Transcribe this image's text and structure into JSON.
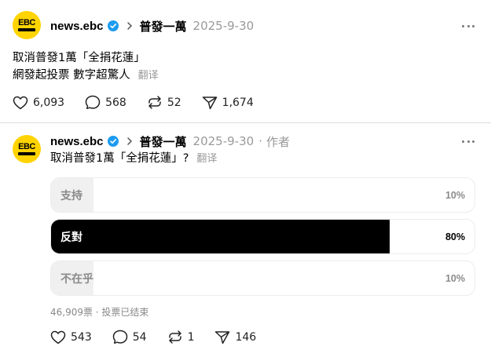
{
  "posts": [
    {
      "username": "news.ebc",
      "topic": "普發一萬",
      "date": "2025-9-30",
      "avatar_text": "EBC",
      "lines": [
        "取消普發1萬「全捐花蓮」",
        "網發起投票 數字超驚人"
      ],
      "translate": "翻译",
      "actions": {
        "likes": "6,093",
        "replies": "568",
        "reposts": "52",
        "shares": "1,674"
      }
    },
    {
      "username": "news.ebc",
      "topic": "普發一萬",
      "date": "2025-9-30",
      "separator": "·",
      "author_tag": "作者",
      "avatar_text": "EBC",
      "text": "取消普發1萬「全捐花蓮」?",
      "translate": "翻译",
      "poll": {
        "options": [
          {
            "label": "支持",
            "percent_text": "10%",
            "percent": 10,
            "selected": false
          },
          {
            "label": "反對",
            "percent_text": "80%",
            "percent": 80,
            "selected": true
          },
          {
            "label": "不在乎",
            "percent_text": "10%",
            "percent": 10,
            "selected": false
          }
        ],
        "meta": "46,909票 · 投票已结束"
      },
      "actions": {
        "likes": "543",
        "replies": "54",
        "reposts": "1",
        "shares": "146"
      }
    }
  ],
  "colors": {
    "verified": "#1d9bf0",
    "avatar_bg": "#ffd400",
    "poll_selected": "#000000",
    "poll_unselected": "#f0f0f0",
    "muted": "#999999"
  },
  "icons": [
    "verified-badge-icon",
    "chevron-right-icon",
    "more-icon",
    "heart-icon",
    "comment-icon",
    "repost-icon",
    "share-icon"
  ]
}
